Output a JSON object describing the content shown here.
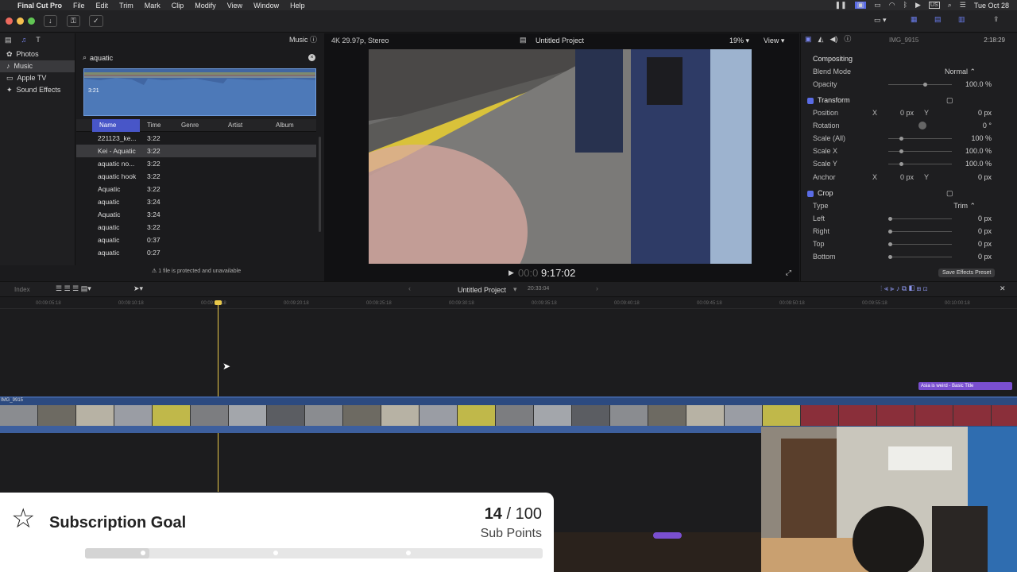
{
  "menubar": {
    "app": "Final Cut Pro",
    "items": [
      "File",
      "Edit",
      "Trim",
      "Mark",
      "Clip",
      "Modify",
      "View",
      "Window",
      "Help"
    ],
    "clock": "Tue Oct 28"
  },
  "library": {
    "items": [
      {
        "label": "Photos",
        "icon": "photos-icon"
      },
      {
        "label": "Music",
        "icon": "music-icon"
      },
      {
        "label": "Apple TV",
        "icon": "apple-tv-icon"
      },
      {
        "label": "Sound Effects",
        "icon": "sound-effects-icon"
      }
    ]
  },
  "browser": {
    "title": "Music",
    "search_value": "aquatic",
    "preview_time": "3:21",
    "columns": [
      "Name",
      "Time",
      "Genre",
      "Artist",
      "Album"
    ],
    "rows": [
      {
        "name": "221123_ke...",
        "time": "3:22"
      },
      {
        "name": "Kei - Aquatic",
        "time": "3:22"
      },
      {
        "name": "aquatic no...",
        "time": "3:22"
      },
      {
        "name": "aquatic hook",
        "time": "3:22"
      },
      {
        "name": "Aquatic",
        "time": "3:22"
      },
      {
        "name": "aquatic",
        "time": "3:24"
      },
      {
        "name": "Aquatic",
        "time": "3:24"
      },
      {
        "name": "aquatic",
        "time": "3:22"
      },
      {
        "name": "aquatic",
        "time": "0:37"
      },
      {
        "name": "aquatic",
        "time": "0:27"
      }
    ],
    "status": "1 file is protected and unavailable"
  },
  "viewer": {
    "format": "4K 29.97p, Stereo",
    "project": "Untitled Project",
    "zoom": "19%",
    "view_label": "View",
    "timecode_dim": "00:0",
    "timecode": "9:17:02"
  },
  "inspector": {
    "clip_name": "IMG_9915",
    "duration": "2:18:29",
    "compositing": "Compositing",
    "blend_mode_label": "Blend Mode",
    "blend_mode_value": "Normal ⌃",
    "opacity_label": "Opacity",
    "opacity_value": "100.0 %",
    "transform": "Transform",
    "position_label": "Position",
    "position_x": "0 px",
    "position_y": "0 px",
    "rotation_label": "Rotation",
    "rotation_value": "0 °",
    "scale_all_label": "Scale (All)",
    "scale_all_value": "100 %",
    "scale_x_label": "Scale X",
    "scale_x_value": "100.0 %",
    "scale_y_label": "Scale Y",
    "scale_y_value": "100.0 %",
    "anchor_label": "Anchor",
    "anchor_x": "0 px",
    "anchor_y": "0 px",
    "crop": "Crop",
    "type_label": "Type",
    "type_value": "Trim ⌃",
    "left_label": "Left",
    "left_value": "0 px",
    "right_label": "Right",
    "right_value": "0 px",
    "top_label": "Top",
    "top_value": "0 px",
    "bottom_label": "Bottom",
    "bottom_value": "0 px",
    "save_preset": "Save Effects Preset",
    "x": "X",
    "y": "Y"
  },
  "timeline": {
    "index": "Index",
    "project": "Untitled Project",
    "duration": "20:33:04",
    "ruler": [
      "00:09:05:18",
      "00:09:10:18",
      "00:09:15:18",
      "00:09:20:18",
      "00:09:25:18",
      "00:09:30:18",
      "00:09:35:18",
      "00:09:40:18",
      "00:09:45:18",
      "00:09:50:18",
      "00:09:55:18",
      "00:10:00:18"
    ],
    "clip_label": "IMG_9915",
    "title_clip": "Asia is weird - Basic Title"
  },
  "goal": {
    "title": "Subscription Goal",
    "current": "14",
    "separator": "/",
    "target": "100",
    "unit": "Sub Points",
    "progress": 0.14
  },
  "colors": {
    "accent": "#5a6ce6",
    "clip_blue": "#3d5f9e",
    "title_purple": "#7a4fd0",
    "playhead": "#e8c84a"
  }
}
